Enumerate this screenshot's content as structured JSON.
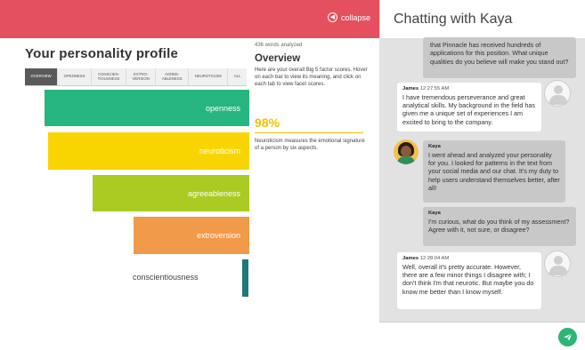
{
  "header": {
    "collapse_label": "collapse",
    "accent": "#e5505f"
  },
  "profile": {
    "title": "Your personality profile",
    "tabs": [
      {
        "label": "OVERVIEW",
        "active": true
      },
      {
        "label": "OPENNESS",
        "active": false
      },
      {
        "label": "CONSCIEN-\nTIOUSNESS",
        "active": false
      },
      {
        "label": "EXTRO-\nVERSION",
        "active": false
      },
      {
        "label": "AGREE-\nABLENESS",
        "active": false
      },
      {
        "label": "NEUROTICISM",
        "active": false
      },
      {
        "label": "ALL",
        "active": false
      }
    ],
    "bars": [
      {
        "label": "openness",
        "color": "#27b57f"
      },
      {
        "label": "neuroticism",
        "color": "#f8d500"
      },
      {
        "label": "agreeableness",
        "color": "#a9cb22"
      },
      {
        "label": "extroversion",
        "color": "#f09a4a"
      },
      {
        "label": "conscientiousness",
        "color": "#1e7a7a"
      }
    ]
  },
  "info": {
    "words_analyzed": "436 words analyzed",
    "title": "Overview",
    "description": "Here are your overall Big 5 factor scores. Hover on each bar to view its meaning, and click on each tab to view facet scores.",
    "score": "98%",
    "note": "Neuroticism measures the emotional signature of a person by six aspects."
  },
  "chat": {
    "title": "Chatting with Kaya",
    "messages": [
      {
        "sender": "",
        "time": "",
        "text": "that Pinnacle has received hundreds of applications for this position. What unique qualities do you believe will make you stand out?"
      },
      {
        "sender": "James",
        "time": "12:27:55 AM",
        "text": "I have tremendous perseverance and great analytical skills. My background in the field has given me a unique set of experiences I am excited to bring to the company."
      },
      {
        "sender": "Kaya",
        "time": "",
        "text": "I went ahead and analyzed your personality for you. I looked for patterns in the text from your social media and our chat. It's my duty to help users understand themselves better, after all!"
      },
      {
        "sender": "Kaya",
        "time": "",
        "text": "I'm curious, what do you think of my assessment? Agree with it, not sure, or disagree?"
      },
      {
        "sender": "James",
        "time": "12:28:04 AM",
        "text": "Well, overall it's pretty accurate. However, there are a few minor things I disagree with; I don't think I'm that neurotic. But maybe you do know me better than I know myself."
      }
    ],
    "send_color": "#2bb673"
  }
}
